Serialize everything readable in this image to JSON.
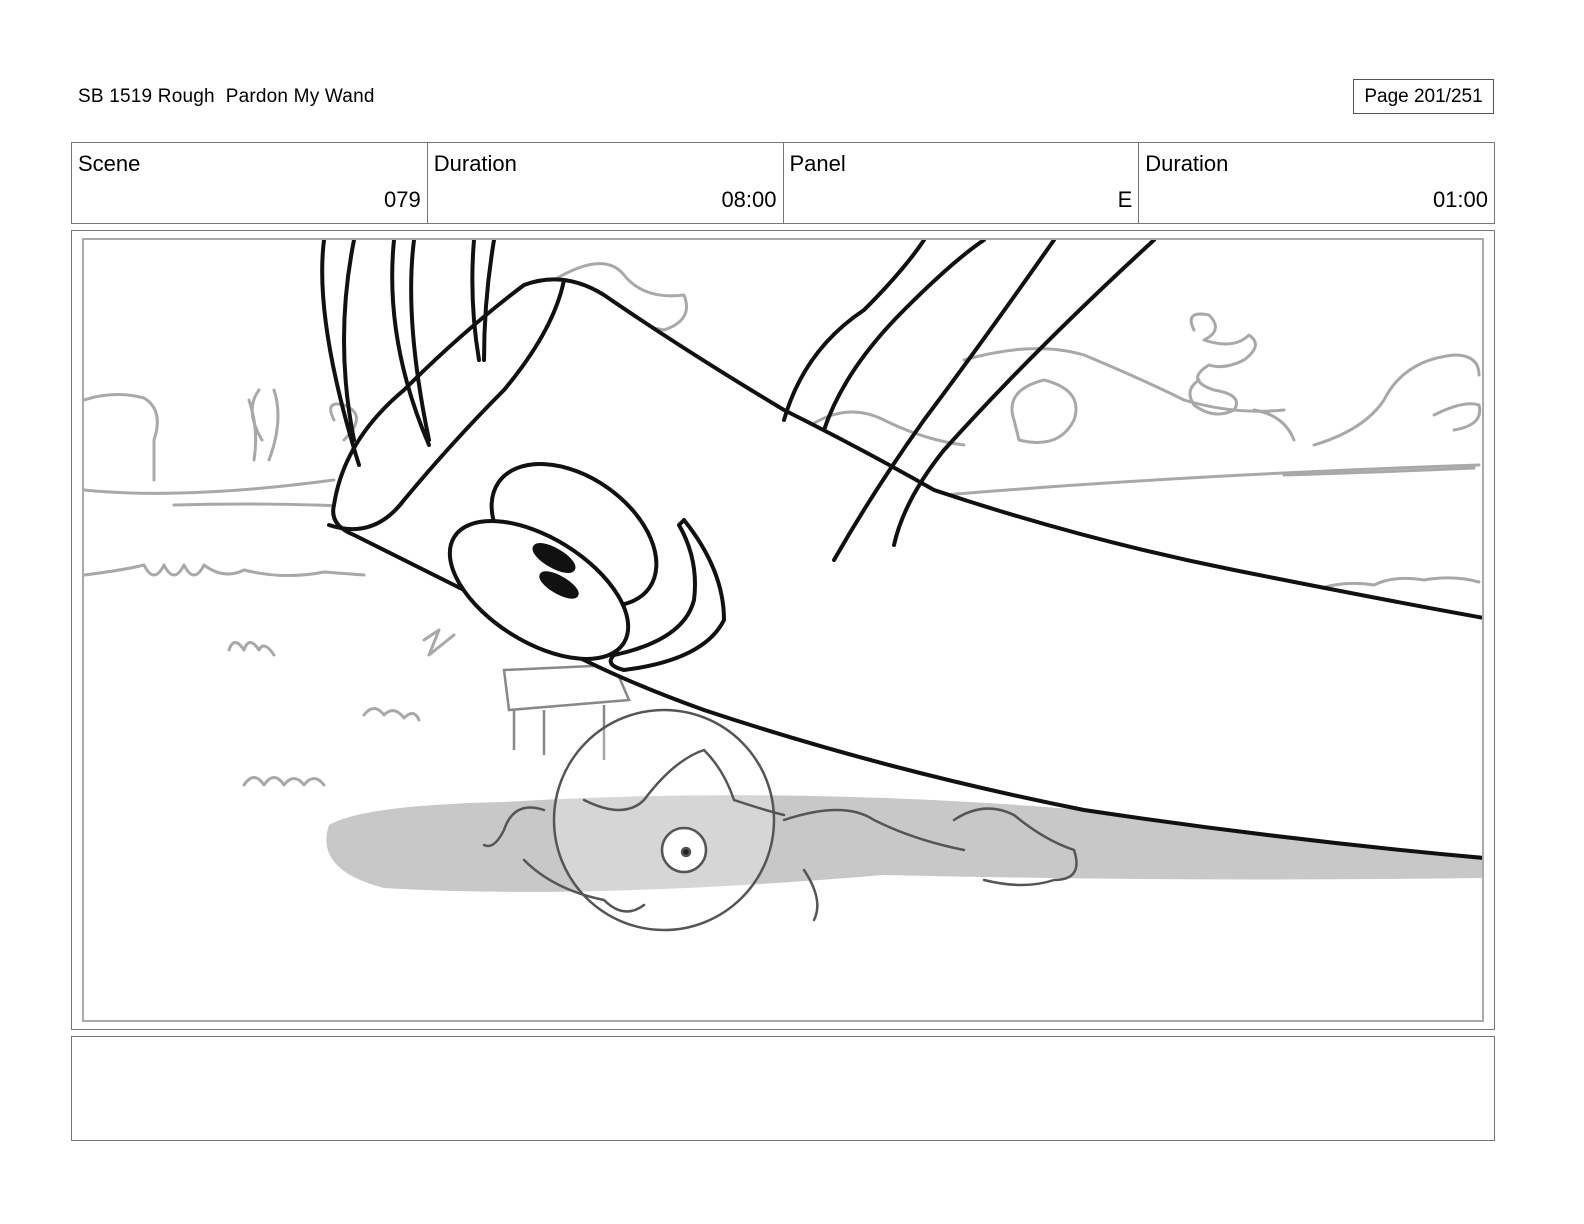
{
  "header": {
    "title": "SB 1519 Rough  Pardon My Wand",
    "page": "Page 201/251"
  },
  "info": [
    {
      "label": "Scene",
      "value": "079"
    },
    {
      "label": "Duration",
      "value": "08:00"
    },
    {
      "label": "Panel",
      "value": "E"
    },
    {
      "label": "Duration",
      "value": "01:00"
    }
  ],
  "notes": ""
}
